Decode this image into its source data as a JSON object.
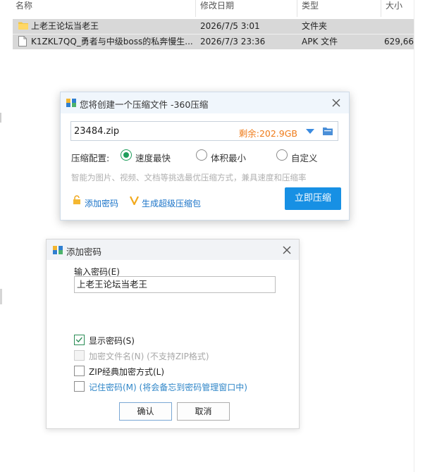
{
  "explorer": {
    "columns": [
      {
        "label": "名称"
      },
      {
        "label": "修改日期"
      },
      {
        "label": "类型"
      },
      {
        "label": "大小"
      }
    ],
    "rows": [
      {
        "icon": "folder-icon",
        "name": "上老王论坛当老王",
        "date": "2026/7/5 3:01",
        "type": "文件夹",
        "size": ""
      },
      {
        "icon": "file-icon",
        "name": "K1ZKL7QQ_勇者与中级boss的私奔慢生...",
        "date": "2026/7/3 23:36",
        "type": "APK 文件",
        "size": "629,66"
      }
    ]
  },
  "compress_dialog": {
    "title": "您将创建一个压缩文件 -360压缩",
    "file_name": "23484.zip",
    "free_space": "剩余:202.9GB",
    "config_label": "压缩配置:",
    "options": [
      {
        "label": "速度最快",
        "checked": true
      },
      {
        "label": "体积最小",
        "checked": false
      },
      {
        "label": "自定义",
        "checked": false
      }
    ],
    "hint": "智能为图片、视频、文档等挑选最优压缩方式，兼具速度和压缩率",
    "add_password_label": "添加密码",
    "super_package_label": "生成超级压缩包",
    "compress_button": "立即压缩",
    "accent_color": "#1790e4",
    "space_color": "#ef7b19"
  },
  "password_dialog": {
    "title": "添加密码",
    "input_label": "输入密码(E)",
    "password_value": "上老王论坛当老王",
    "checkboxes": [
      {
        "label": "显示密码(S)",
        "checked": true,
        "disabled": false
      },
      {
        "label": "加密文件名(N) (不支持ZIP格式)",
        "checked": false,
        "disabled": true
      },
      {
        "label": "ZIP经典加密方式(L)",
        "checked": false,
        "disabled": false
      },
      {
        "label": "记住密码(M) (将会备忘到密码管理窗口中)",
        "checked": false,
        "disabled": false
      }
    ],
    "ok_button": "确认",
    "cancel_button": "取消"
  }
}
